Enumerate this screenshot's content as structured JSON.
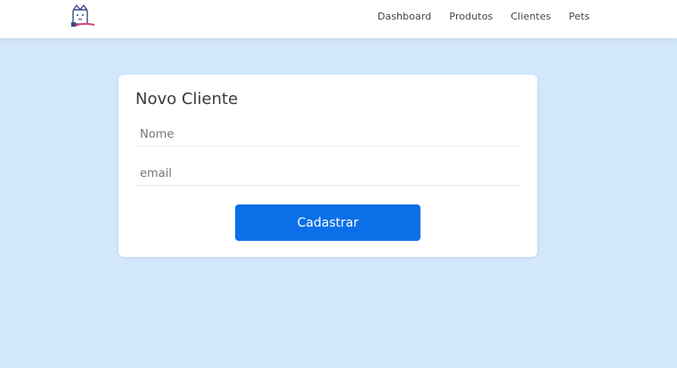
{
  "navbar": {
    "logo_icon": "dog-shop-logo-icon",
    "links": [
      "Dashboard",
      "Produtos",
      "Clientes",
      "Pets"
    ]
  },
  "form": {
    "title": "Novo Cliente",
    "name_placeholder": "Nome",
    "email_placeholder": "email",
    "submit_label": "Cadastrar"
  },
  "colors": {
    "background": "#d3e7fc",
    "primary_button": "#0b6fe8",
    "card": "#ffffff"
  }
}
